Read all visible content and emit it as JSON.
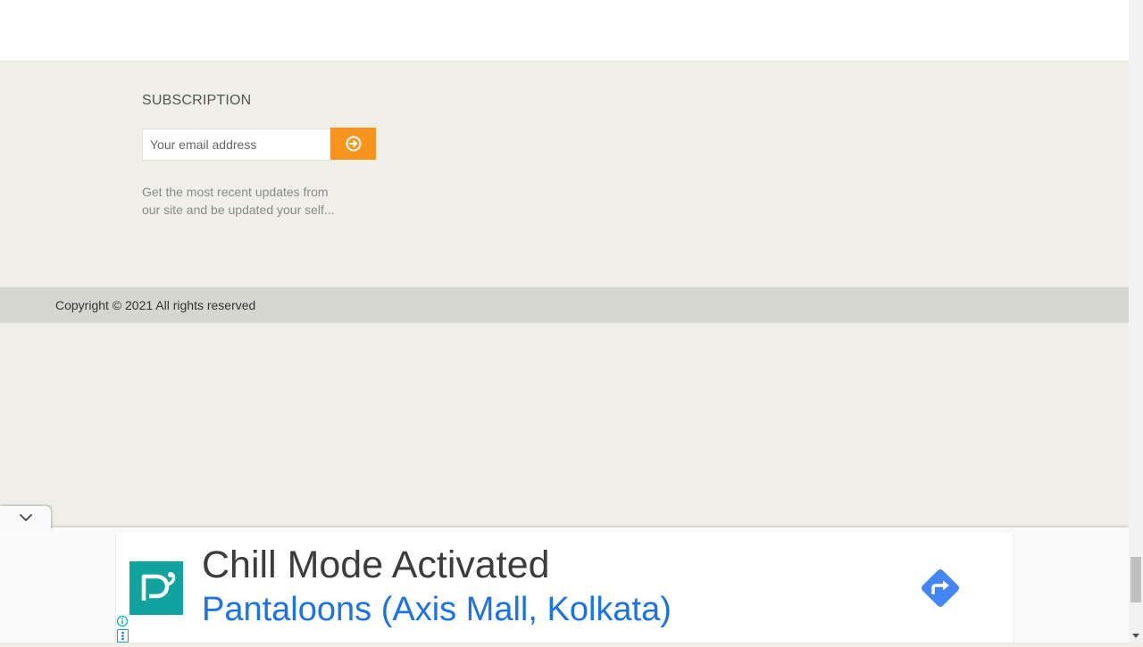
{
  "footer": {
    "subscription": {
      "title": "SUBSCRIPTION",
      "email_placeholder": "Your email address",
      "submit_icon": "arrow-circle-right-icon",
      "description": "Get the most recent updates from our site and be updated your self..."
    },
    "copyright": "Copyright © 2021 All rights reserved"
  },
  "ad": {
    "collapse_icon": "chevron-down-icon",
    "logo_icon": "pantaloons-logo-icon",
    "headline": "Chill Mode Activated",
    "subline": "Pantaloons (Axis Mall, Kolkata)",
    "direction_icon": "directions-icon",
    "info_icon": "info-icon",
    "adchoices_icon": "adchoices-icon"
  },
  "colors": {
    "accent": "#f7941d",
    "footer_bg": "#efeee9",
    "copyright_bg": "#d6d6d1",
    "ad_logo_bg": "#10a3a0",
    "ad_link": "#1a73e8",
    "direction_blue": "#4285f4"
  }
}
